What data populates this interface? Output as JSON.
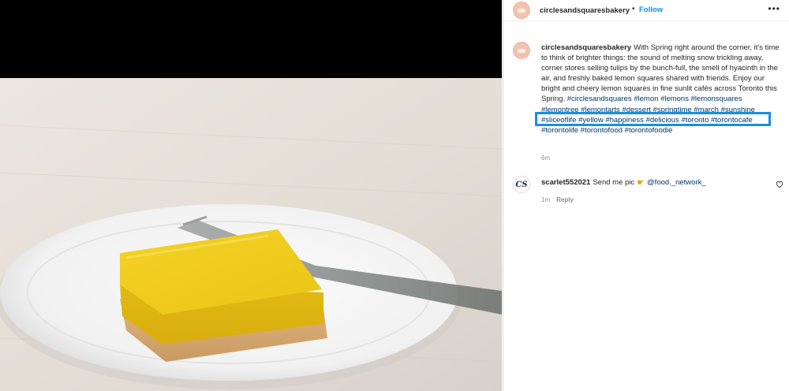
{
  "post": {
    "author": "circlesandsquaresbakery",
    "follow_label": "Follow",
    "separator": "•",
    "more_label": "•••",
    "caption": {
      "username": "circlesandsquaresbakery",
      "text": "With Spring right around the corner, it's time to think of brighter things: the sound of melting snow trickling away, corner stores selling tulips by the bunch-full, the smell of hyacinth in the air, and freshly baked lemon squares shared with friends. Enjoy our bright and cheery lemon squares in fine sunlit cafés across Toronto this Spring.",
      "hashtags": [
        "#circlesandsquares",
        "#lemon",
        "#lemons",
        "#lemonsquares",
        "#lemontree",
        "#lemontarts",
        "#dessert",
        "#springtime",
        "#march",
        "#sunshine",
        "#sliceoflife",
        "#yellow",
        "#happiness",
        "#delicious",
        "#toronto",
        "#torontocafe",
        "#torontolife",
        "#torontofood",
        "#torontofoodie"
      ],
      "time": "6m"
    },
    "comments": [
      {
        "avatar_text": "CS",
        "username": "scarlet552021",
        "text": "Send me pic",
        "icon": "pointing-hand-icon",
        "mention": "@food._network_",
        "time": "1m",
        "reply_label": "Reply"
      }
    ]
  },
  "colors": {
    "accent": "#0095f6",
    "hashtag": "#00376b",
    "highlight": "#1a8fe0",
    "avatar": "#f2c3ae"
  }
}
